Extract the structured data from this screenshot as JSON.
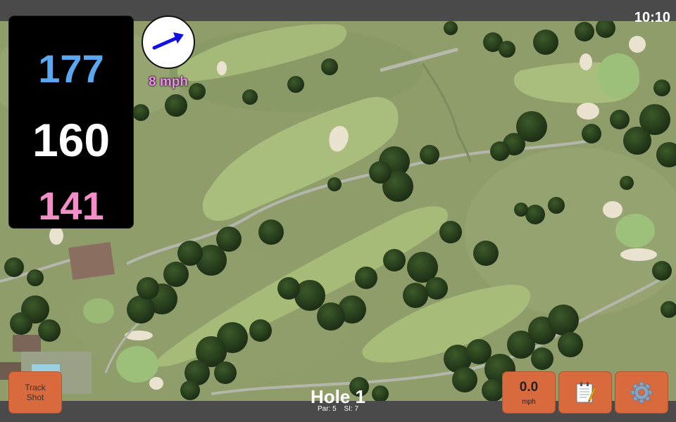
{
  "status": {
    "time": "10:10"
  },
  "distances": {
    "back": {
      "value": "177",
      "color": "#5aa8f0"
    },
    "middle": {
      "value": "160",
      "color": "#ffffff"
    },
    "front": {
      "value": "141",
      "color": "#f28ec8"
    }
  },
  "wind": {
    "speed_label": "8 mph",
    "direction_icon": "arrow-icon",
    "arrow_color": "#1010e0"
  },
  "hole": {
    "title": "Hole 1",
    "par_label": "Par: 5",
    "si_label": "SI: 7"
  },
  "buttons": {
    "track_shot_line1": "Track",
    "track_shot_line2": "Shot",
    "speed_value": "0.0",
    "speed_unit": "mph",
    "notes_icon": "notepad-icon",
    "settings_icon": "gear-icon"
  },
  "colors": {
    "accent_button": "#d96a3d",
    "bar": "#4a4a4a"
  }
}
